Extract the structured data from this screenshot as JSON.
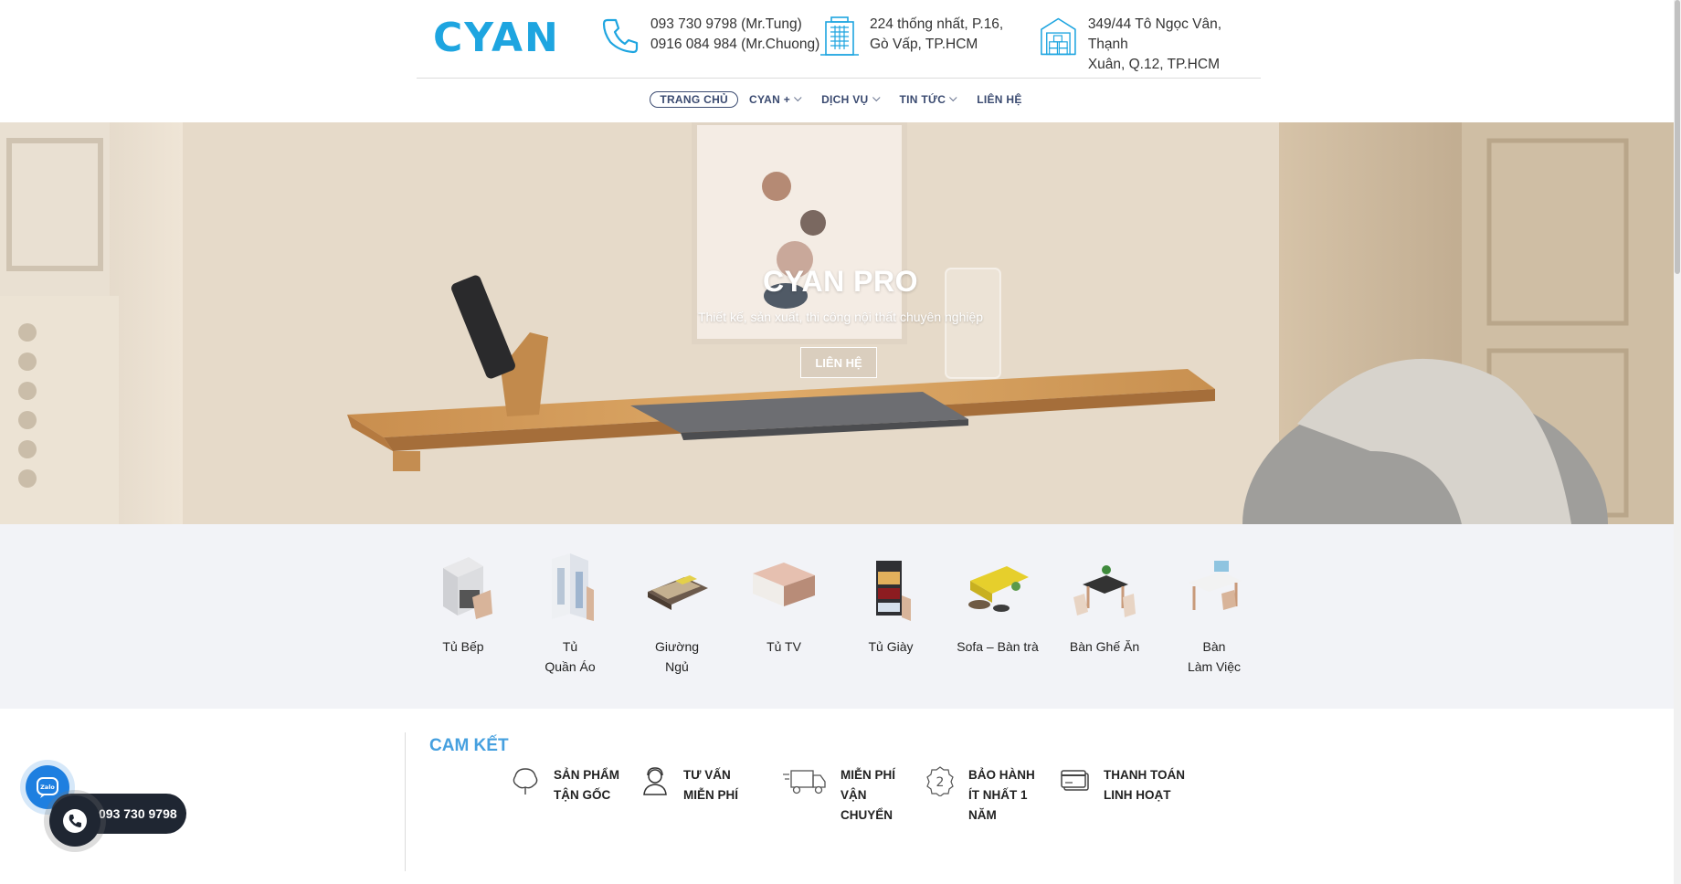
{
  "brand": {
    "logo": "CYAN",
    "accent": "#1ea5e0"
  },
  "contacts": [
    {
      "icon": "phone-icon",
      "line1": "093 730 9798 (Mr.Tung)",
      "line2": "0916 084 984 (Mr.Chuong)"
    },
    {
      "icon": "building-icon",
      "line1": "224 thống nhất, P.16,",
      "line2": "Gò Vấp, TP.HCM"
    },
    {
      "icon": "factory-icon",
      "line1": "349/44 Tô Ngọc Vân, Thạnh",
      "line2": "Xuân, Q.12, TP.HCM"
    }
  ],
  "nav": [
    {
      "label": "TRANG CHỦ",
      "active": true
    },
    {
      "label": "CYAN +",
      "dropdown": true
    },
    {
      "label": "DỊCH VỤ",
      "dropdown": true
    },
    {
      "label": "TIN TỨC",
      "dropdown": true
    },
    {
      "label": "LIÊN HỆ"
    }
  ],
  "hero": {
    "title": "CYAN PRO",
    "subtitle": "Thiết kế, sản xuất, thi công nội thất chuyên nghiệp",
    "button": "LIÊN HỆ"
  },
  "categories": [
    {
      "label": "Tủ Bếp",
      "icon": "kitchen-cabinet-icon"
    },
    {
      "label": "Tủ\nQuần Áo",
      "icon": "wardrobe-icon"
    },
    {
      "label": "Giường\nNgủ",
      "icon": "bed-icon"
    },
    {
      "label": "Tủ TV",
      "icon": "tv-cabinet-icon"
    },
    {
      "label": "Tủ Giày",
      "icon": "shoe-cabinet-icon"
    },
    {
      "label": "Sofa – Bàn trà",
      "icon": "sofa-icon"
    },
    {
      "label": "Bàn Ghế Ăn",
      "icon": "dining-table-icon"
    },
    {
      "label": "Bàn\nLàm Việc",
      "icon": "work-desk-icon"
    }
  ],
  "commitment": {
    "title": "CAM KẾT",
    "items": [
      {
        "label": "SẢN PHẨM\nTẬN GỐC",
        "icon": "tree-icon"
      },
      {
        "label": "TƯ VẤN\nMIỄN PHÍ",
        "icon": "consultant-icon"
      },
      {
        "label": "MIỄN PHÍ\nVẬN\nCHUYỂN",
        "icon": "truck-icon"
      },
      {
        "label": "BẢO HÀNH\nÍT NHẤT 1\nNĂM",
        "icon": "warranty-badge-icon"
      },
      {
        "label": "THANH TOÁN\nLINH HOẠT",
        "icon": "credit-card-icon"
      }
    ]
  },
  "floating": {
    "zalo_label": "Zalo",
    "phone": "093 730 9798"
  }
}
